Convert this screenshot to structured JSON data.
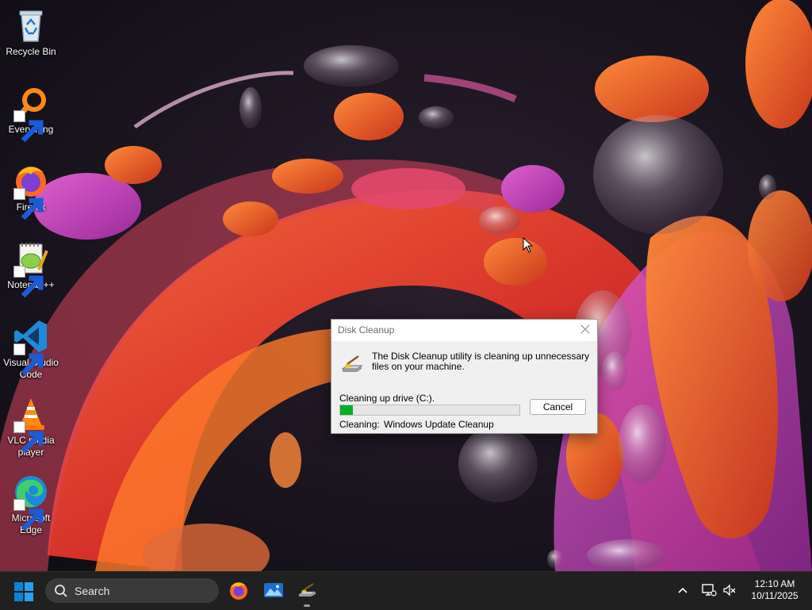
{
  "desktop": {
    "icons": [
      {
        "label": "Recycle Bin",
        "icon": "recycle-bin-icon"
      },
      {
        "label": "Everything",
        "icon": "everything-search-icon"
      },
      {
        "label": "Firefox",
        "icon": "firefox-icon"
      },
      {
        "label": "Notepad++",
        "icon": "notepad-plus-plus-icon"
      },
      {
        "label": "Visual Studio Code",
        "icon": "vscode-icon"
      },
      {
        "label": "VLC media player",
        "icon": "vlc-icon"
      },
      {
        "label": "Microsoft Edge",
        "icon": "edge-icon"
      }
    ]
  },
  "dialog": {
    "title": "Disk Cleanup",
    "icon": "disk-cleanup-icon",
    "message": "The Disk Cleanup utility is cleaning up unnecessary files on your machine.",
    "drive_label": "Cleaning up drive  (C:).",
    "progress_percent": 7,
    "cancel_label": "Cancel",
    "status_label": "Cleaning:",
    "status_value": "Windows Update Cleanup"
  },
  "taskbar": {
    "search_placeholder": "Search",
    "pinned": [
      {
        "name": "Firefox",
        "icon": "firefox-icon"
      },
      {
        "name": "Photos",
        "icon": "photos-icon"
      },
      {
        "name": "Disk Cleanup",
        "icon": "disk-cleanup-icon",
        "active": true
      }
    ],
    "tray_icons": [
      "chevron-up-icon",
      "network-icon",
      "volume-muted-icon"
    ],
    "time": "12:10 AM",
    "date": "10/11/2025"
  },
  "colors": {
    "progress_green": "#06b025",
    "taskbar": "#202020",
    "start_blue": "#0a84d6"
  }
}
